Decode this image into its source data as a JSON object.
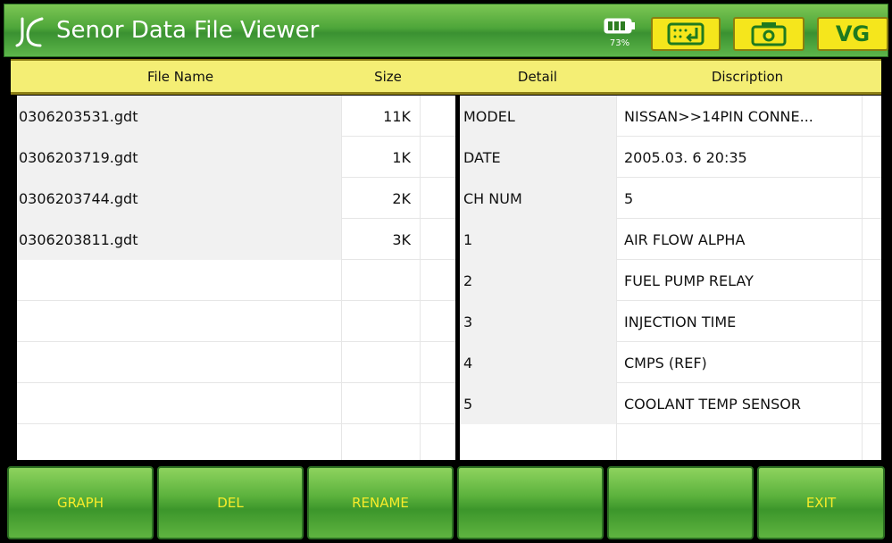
{
  "title_bar": {
    "title": "Senor Data File Viewer",
    "battery_percent": "73%",
    "vg_label": "VG",
    "icons": [
      "logo-icon",
      "battery-icon",
      "keyboard-enter-icon",
      "camera-icon"
    ]
  },
  "file_table": {
    "headers": {
      "name": "File Name",
      "size": "Size"
    },
    "rows": [
      {
        "name": "0306203531.gdt",
        "size": "11K"
      },
      {
        "name": "0306203719.gdt",
        "size": "1K"
      },
      {
        "name": "0306203744.gdt",
        "size": "2K"
      },
      {
        "name": "0306203811.gdt",
        "size": "3K"
      }
    ]
  },
  "detail_table": {
    "headers": {
      "detail": "Detail",
      "description": "Discription"
    },
    "rows": [
      {
        "detail": "MODEL",
        "description": "NISSAN>>14PIN CONNE..."
      },
      {
        "detail": "DATE",
        "description": "2005.03. 6 20:35"
      },
      {
        "detail": "CH NUM",
        "description": "5"
      },
      {
        "detail": "1",
        "description": "AIR FLOW ALPHA"
      },
      {
        "detail": "2",
        "description": "FUEL PUMP RELAY"
      },
      {
        "detail": "3",
        "description": "INJECTION TIME"
      },
      {
        "detail": "4",
        "description": "CMPS (REF)"
      },
      {
        "detail": "5",
        "description": "COOLANT TEMP SENSOR"
      }
    ]
  },
  "bottom_buttons": {
    "graph": "GRAPH",
    "del": "DEL",
    "rename": "RENAME",
    "blank1": "",
    "blank2": "",
    "exit": "EXIT"
  },
  "colors": {
    "title_green": "#4ea63a",
    "header_yellow": "#f4ee74",
    "button_yellow": "#f5e61c",
    "button_text": "#f7ec2a"
  }
}
